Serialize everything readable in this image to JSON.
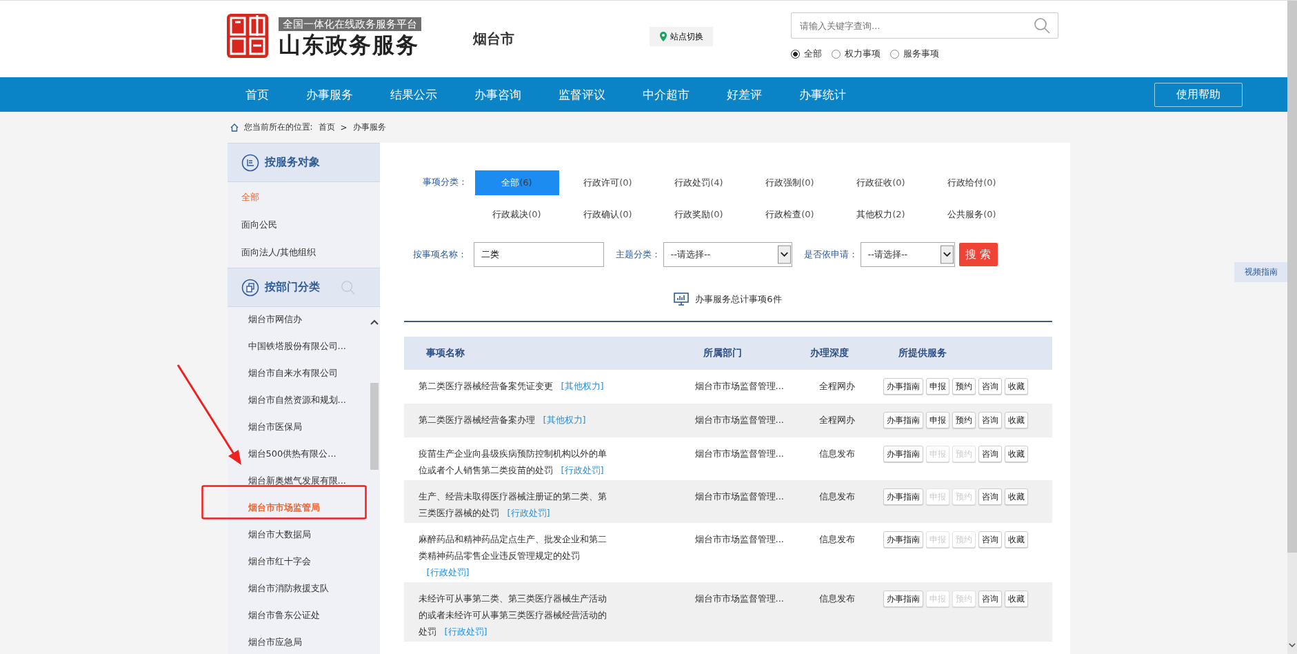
{
  "header": {
    "platform_label": "全国一体化在线政务服务平台",
    "site_title": "山东政务服务",
    "city": "烟台市",
    "site_switch": "站点切换",
    "search": {
      "placeholder": "请输入关键字查询..."
    },
    "scopes": [
      {
        "label": "全部",
        "selected": true
      },
      {
        "label": "权力事项",
        "selected": false
      },
      {
        "label": "服务事项",
        "selected": false
      }
    ]
  },
  "nav": {
    "items": [
      "首页",
      "办事服务",
      "结果公示",
      "办事咨询",
      "监督评议",
      "中介超市",
      "好差评",
      "办事统计"
    ],
    "help": "使用帮助"
  },
  "breadcrumb": {
    "label": "您当前所在的位置:",
    "items": [
      "首页",
      "办事服务"
    ],
    "separator": ">"
  },
  "sidebar": {
    "sections": [
      {
        "title": "按服务对象",
        "kind": "audience",
        "items": [
          {
            "label": "全部",
            "selected": true
          },
          {
            "label": "面向公民",
            "selected": false
          },
          {
            "label": "面向法人/其他组织",
            "selected": false
          }
        ]
      },
      {
        "title": "按部门分类",
        "kind": "department",
        "items": [
          {
            "label": "烟台市网信办",
            "selected": false
          },
          {
            "label": "中国铁塔股份有限公司...",
            "selected": false
          },
          {
            "label": "烟台市自来水有限公司",
            "selected": false
          },
          {
            "label": "烟台市自然资源和规划...",
            "selected": false
          },
          {
            "label": "烟台市医保局",
            "selected": false
          },
          {
            "label": "烟台500供热有限公...",
            "selected": false
          },
          {
            "label": "烟台新奥燃气发展有限...",
            "selected": false
          },
          {
            "label": "烟台市市场监管局",
            "selected": true
          },
          {
            "label": "烟台市大数据局",
            "selected": false
          },
          {
            "label": "烟台市红十字会",
            "selected": false
          },
          {
            "label": "烟台市消防救援支队",
            "selected": false
          },
          {
            "label": "烟台市鲁东公证处",
            "selected": false
          },
          {
            "label": "烟台市应急局",
            "selected": false
          }
        ]
      }
    ]
  },
  "side_tab": "视频指南",
  "filters": {
    "label": "事项分类：",
    "categories": [
      {
        "label": "全部",
        "count": "(6)",
        "selected": true
      },
      {
        "label": "行政许可",
        "count": "(0)",
        "selected": false
      },
      {
        "label": "行政处罚",
        "count": "(4)",
        "selected": false
      },
      {
        "label": "行政强制",
        "count": "(0)",
        "selected": false
      },
      {
        "label": "行政征收",
        "count": "(0)",
        "selected": false
      },
      {
        "label": "行政给付",
        "count": "(0)",
        "selected": false
      },
      {
        "label": "行政裁决",
        "count": "(0)",
        "selected": false
      },
      {
        "label": "行政确认",
        "count": "(0)",
        "selected": false
      },
      {
        "label": "行政奖励",
        "count": "(0)",
        "selected": false
      },
      {
        "label": "行政检查",
        "count": "(0)",
        "selected": false
      },
      {
        "label": "其他权力",
        "count": "(2)",
        "selected": false
      },
      {
        "label": "公共服务",
        "count": "(0)",
        "selected": false
      }
    ]
  },
  "search_form": {
    "name_label": "按事项名称：",
    "name_value": "二类",
    "topic_label": "主题分类：",
    "topic_value": "--请选择--",
    "apply_label": "是否依申请：",
    "apply_value": "--请选择--",
    "button": "搜 索"
  },
  "summary": "办事服务总计事项6件",
  "table": {
    "columns": [
      "事项名称",
      "所属部门",
      "办理深度",
      "所提供服务"
    ],
    "rows": [
      {
        "name": "第二类医疗器械经营备案凭证变更",
        "tag": "[其他权力]",
        "department": "烟台市市场监督管理...",
        "depth": "全程网办",
        "services": [
          {
            "label": "办事指南",
            "disabled": false
          },
          {
            "label": "申报",
            "disabled": false
          },
          {
            "label": "预约",
            "disabled": false
          },
          {
            "label": "咨询",
            "disabled": false
          },
          {
            "label": "收藏",
            "disabled": false
          }
        ]
      },
      {
        "name": "第二类医疗器械经营备案办理",
        "tag": "[其他权力]",
        "department": "烟台市市场监督管理...",
        "depth": "全程网办",
        "services": [
          {
            "label": "办事指南",
            "disabled": false
          },
          {
            "label": "申报",
            "disabled": false
          },
          {
            "label": "预约",
            "disabled": false
          },
          {
            "label": "咨询",
            "disabled": false
          },
          {
            "label": "收藏",
            "disabled": false
          }
        ]
      },
      {
        "name": "疫苗生产企业向县级疾病预防控制机构以外的单位或者个人销售第二类疫苗的处罚",
        "tag": "[行政处罚]",
        "department": "烟台市市场监督管理...",
        "depth": "信息发布",
        "services": [
          {
            "label": "办事指南",
            "disabled": false
          },
          {
            "label": "申报",
            "disabled": true
          },
          {
            "label": "预约",
            "disabled": true
          },
          {
            "label": "咨询",
            "disabled": false
          },
          {
            "label": "收藏",
            "disabled": false
          }
        ]
      },
      {
        "name": "生产、经营未取得医疗器械注册证的第二类、第三类医疗器械的处罚",
        "tag": "[行政处罚]",
        "department": "烟台市市场监督管理...",
        "depth": "信息发布",
        "services": [
          {
            "label": "办事指南",
            "disabled": false
          },
          {
            "label": "申报",
            "disabled": true
          },
          {
            "label": "预约",
            "disabled": true
          },
          {
            "label": "咨询",
            "disabled": false
          },
          {
            "label": "收藏",
            "disabled": false
          }
        ]
      },
      {
        "name": "麻醉药品和精神药品定点生产、批发企业和第二类精神药品零售企业违反管理规定的处罚",
        "tag": "[行政处罚]",
        "department": "烟台市市场监督管理...",
        "depth": "信息发布",
        "services": [
          {
            "label": "办事指南",
            "disabled": false
          },
          {
            "label": "申报",
            "disabled": true
          },
          {
            "label": "预约",
            "disabled": true
          },
          {
            "label": "咨询",
            "disabled": false
          },
          {
            "label": "收藏",
            "disabled": false
          }
        ]
      },
      {
        "name": "未经许可从事第二类、第三类医疗器械生产活动的或者未经许可从事第三类医疗器械经营活动的处罚",
        "tag": "[行政处罚]",
        "department": "烟台市市场监督管理...",
        "depth": "信息发布",
        "services": [
          {
            "label": "办事指南",
            "disabled": false
          },
          {
            "label": "申报",
            "disabled": true
          },
          {
            "label": "预约",
            "disabled": true
          },
          {
            "label": "咨询",
            "disabled": false
          },
          {
            "label": "收藏",
            "disabled": false
          }
        ]
      }
    ]
  }
}
